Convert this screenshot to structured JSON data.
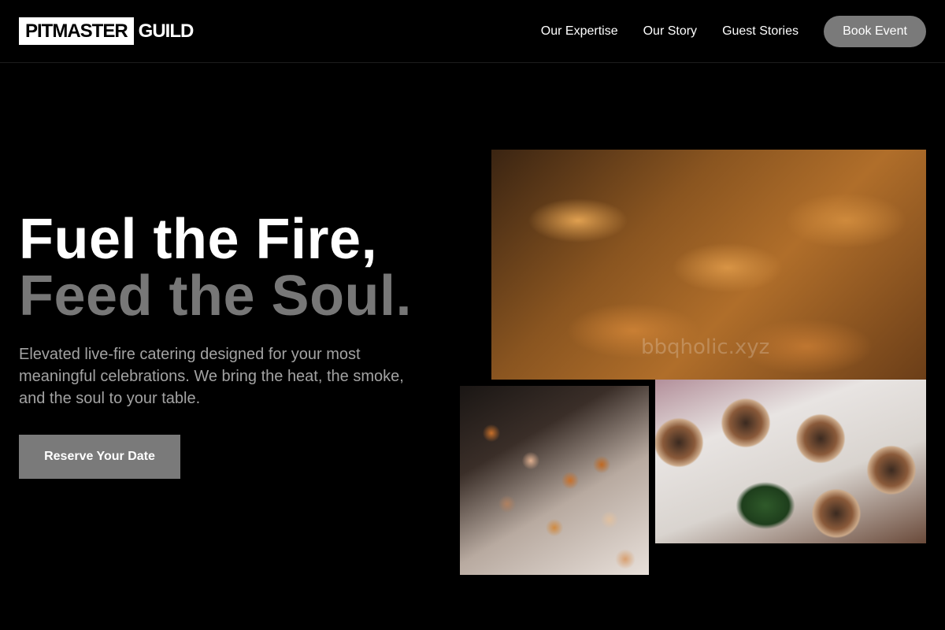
{
  "header": {
    "logo_box": "PITMASTER",
    "logo_text": "GUILD",
    "nav_links": [
      "Our Expertise",
      "Our Story",
      "Guest Stories"
    ],
    "book_button": "Book Event"
  },
  "hero": {
    "headline_line1": "Fuel the Fire,",
    "headline_line2": "Feed the Soul.",
    "subtitle": "Elevated live-fire catering designed for your most meaningful celebrations. We bring the heat, the smoke, and the soul to your table.",
    "cta_label": "Reserve Your Date"
  },
  "images": {
    "watermark": "bbqholic.xyz"
  },
  "colors": {
    "background": "#000000",
    "button_gray": "#7a7a7a",
    "headline_muted": "#777777",
    "subtitle_text": "#a3a3a3"
  }
}
